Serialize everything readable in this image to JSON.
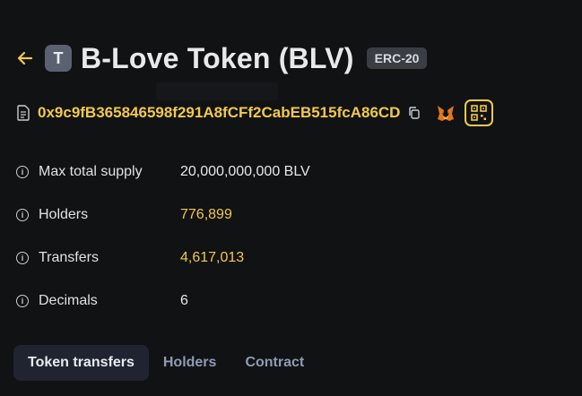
{
  "header": {
    "back_icon": "arrow-left-icon",
    "avatar_letter": "T",
    "title": "B-Love Token (BLV)",
    "standard_badge": "ERC-20"
  },
  "contract": {
    "address": "0x9c9fB365846598f291A8fCFf2CabEB515fcA86CD",
    "icons": [
      "document-icon",
      "copy-icon",
      "metamask-fox-icon",
      "qr-code-icon"
    ]
  },
  "details": [
    {
      "label": "Max total supply",
      "value": "20,000,000,000 BLV",
      "is_link": false
    },
    {
      "label": "Holders",
      "value": "776,899",
      "is_link": true
    },
    {
      "label": "Transfers",
      "value": "4,617,013",
      "is_link": true
    },
    {
      "label": "Decimals",
      "value": "6",
      "is_link": false
    }
  ],
  "tabs": [
    {
      "label": "Token transfers",
      "active": true
    },
    {
      "label": "Holders",
      "active": false
    },
    {
      "label": "Contract",
      "active": false
    }
  ],
  "colors": {
    "background": "#111214",
    "accent": "#f2c94c",
    "tab_active_bg": "#1f2430",
    "tab_inactive": "#8f9bb3"
  }
}
